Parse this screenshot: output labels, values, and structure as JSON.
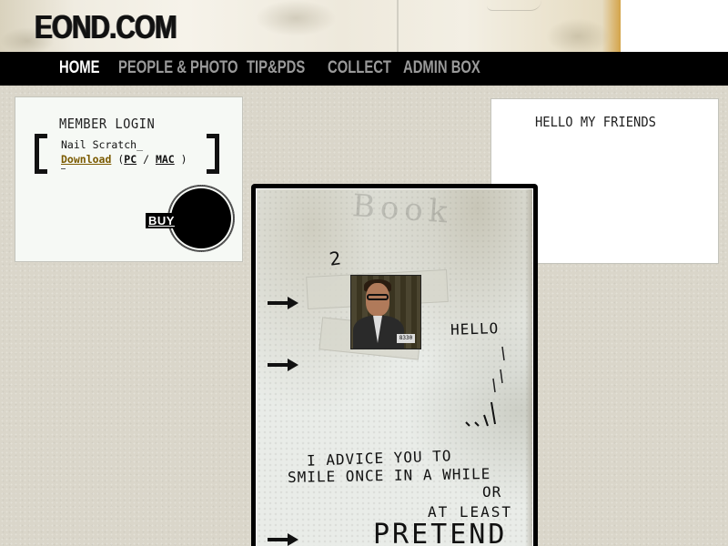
{
  "header": {
    "logo": "EOND.COM"
  },
  "nav": {
    "items": [
      {
        "label": "HOME",
        "active": true
      },
      {
        "label": "PEOPLE & PHOTO",
        "active": false
      },
      {
        "label": "TIP&PDS",
        "active": false
      },
      {
        "label": "COLLECT",
        "active": false
      },
      {
        "label": "ADMIN BOX",
        "active": false
      }
    ]
  },
  "member": {
    "title": "MEMBER LOGIN",
    "name": "Nail Scratch_",
    "download_label": "Download",
    "open_paren": "(",
    "pc_label": "PC",
    "slash": "/",
    "mac_label": "MAC",
    "close_paren": ")",
    "buy_label": "BUY"
  },
  "friends": {
    "title": "HELLO MY FRIENDS"
  },
  "photo": {
    "top_scrawl": "Book",
    "number": "2",
    "mugshot_tag": "8330",
    "hello": "HELLO",
    "note_line1": "I ADVICE YOU TO",
    "note_line2": "SMILE ONCE IN A WHILE",
    "note_line3": "OR",
    "note_line4": "AT LEAST",
    "note_line5": "PRETEND"
  },
  "colors": {
    "nav_bg": "#000000",
    "nav_active": "#ffffff",
    "nav_inactive": "#9a9a9a",
    "download_link": "#7a5a00",
    "page_bg": "#dad6ca"
  }
}
